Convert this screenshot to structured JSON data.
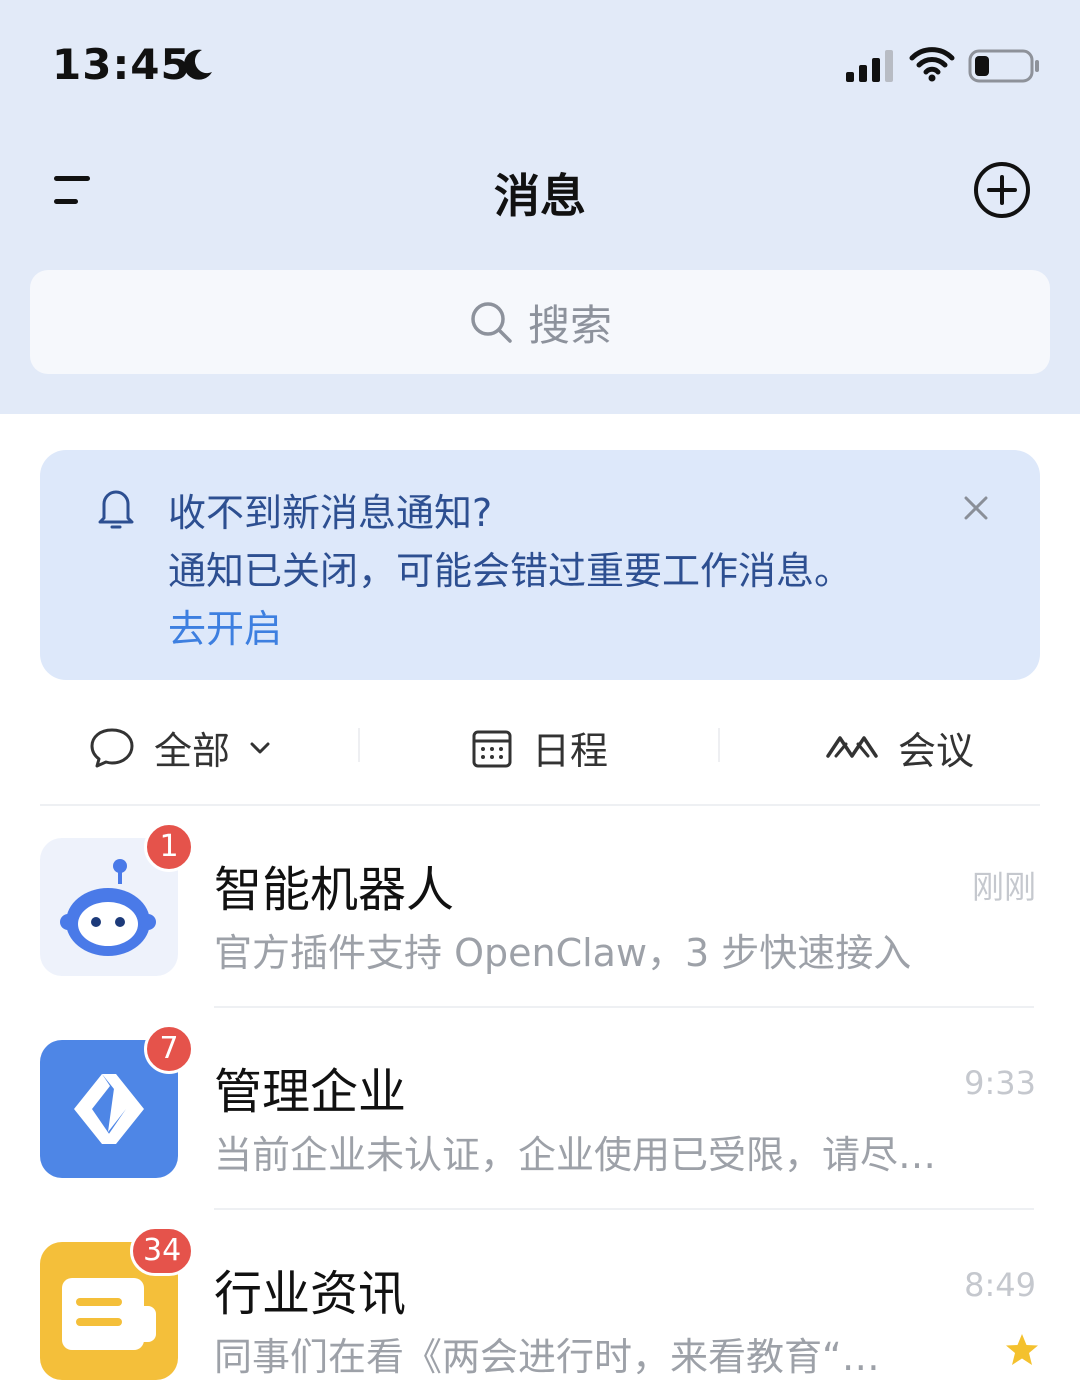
{
  "status_bar": {
    "time": "13:45"
  },
  "header": {
    "title": "消息"
  },
  "search": {
    "placeholder": "搜索"
  },
  "banner": {
    "line1": "收不到新消息通知?",
    "line2": "通知已关闭，可能会错过重要工作消息。",
    "action": "去开启"
  },
  "filters": {
    "all": "全部",
    "schedule": "日程",
    "meeting": "会议"
  },
  "conversations": [
    {
      "name": "智能机器人",
      "preview": "官方插件支持 OpenClaw，3 步快速接入",
      "time": "刚刚",
      "badge": "1"
    },
    {
      "name": "管理企业",
      "preview": "当前企业未认证，企业使用已受限，请尽…",
      "time": "9:33",
      "badge": "7"
    },
    {
      "name": "行业资讯",
      "preview": "同事们在看《两会进行时，来看教育“…",
      "time": "8:49",
      "badge": "34",
      "starred": true
    }
  ],
  "colors": {
    "header_bg": "#e2eaf8",
    "banner_bg": "#dde8fa",
    "banner_text": "#2d4f91",
    "link": "#3d7fe0",
    "badge": "#e5534b",
    "star": "#f4c12e"
  }
}
